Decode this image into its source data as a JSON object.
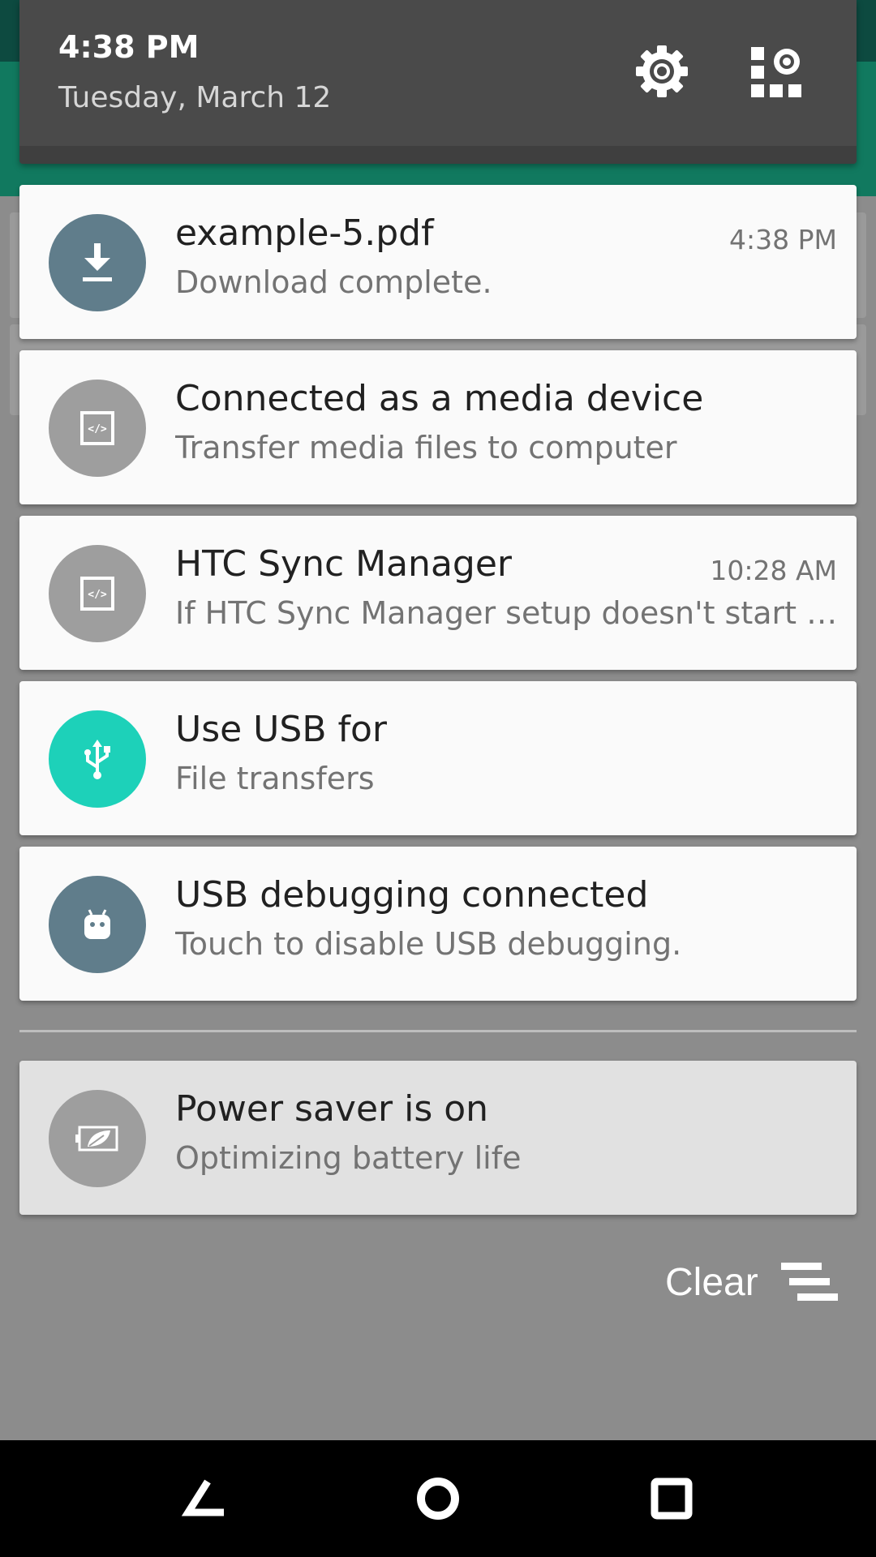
{
  "header": {
    "time": "4:38 PM",
    "date": "Tuesday, March 12",
    "settings_icon": "gear-icon",
    "quick_settings_icon": "quick-settings-icon",
    "background_color": "#4a4a4a"
  },
  "notifications": [
    {
      "title": "example-5.pdf",
      "text": "Download complete.",
      "time": "4:38 PM",
      "icon": "download-icon",
      "icon_color": "#607d8b"
    },
    {
      "title": "Connected as a media device",
      "text": "Transfer media files to computer",
      "time": "",
      "icon": "code-icon",
      "icon_color": "#9e9e9e"
    },
    {
      "title": "HTC Sync Manager",
      "text": "If HTC Sync Manager setup doesn't start a..",
      "time": "10:28 AM",
      "icon": "code-icon",
      "icon_color": "#9e9e9e"
    },
    {
      "title": "Use USB for",
      "text": "File transfers",
      "time": "",
      "icon": "usb-icon",
      "icon_color": "#1dd1b9"
    },
    {
      "title": "USB debugging connected",
      "text": "Touch to disable USB debugging.",
      "time": "",
      "icon": "android-icon",
      "icon_color": "#607d8b"
    },
    {
      "title": "Power saver is on",
      "text": "Optimizing battery life",
      "time": "",
      "icon": "battery-leaf-icon",
      "icon_color": "#9e9e9e"
    }
  ],
  "clear": {
    "label": "Clear",
    "icon": "clear-all-icon"
  },
  "navbar": {
    "back_icon": "back-icon",
    "home_icon": "home-icon",
    "recents_icon": "recents-icon"
  },
  "colors": {
    "app_bar": "#11795f",
    "status_bar": "#0d4a40",
    "scrim": "#8c8c8c"
  }
}
